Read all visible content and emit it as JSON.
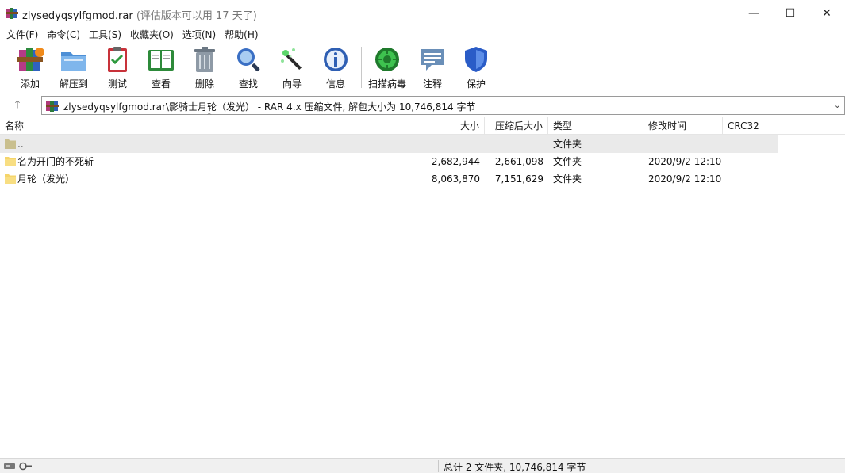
{
  "window": {
    "title": "zlysedyqsylfgmod.rar",
    "trial_note": "(评估版本可以用 17 天了)",
    "minimize_glyph": "—",
    "maximize_glyph": "☐",
    "close_glyph": "✕"
  },
  "menu": [
    {
      "label": "文件(F)"
    },
    {
      "label": "命令(C)"
    },
    {
      "label": "工具(S)"
    },
    {
      "label": "收藏夹(O)"
    },
    {
      "label": "选项(N)"
    },
    {
      "label": "帮助(H)"
    }
  ],
  "toolbar": [
    {
      "label": "添加",
      "icon": "add-archive-icon"
    },
    {
      "label": "解压到",
      "icon": "extract-folder-icon"
    },
    {
      "label": "测试",
      "icon": "test-clipboard-icon"
    },
    {
      "label": "查看",
      "icon": "view-book-icon"
    },
    {
      "label": "删除",
      "icon": "trash-icon"
    },
    {
      "label": "查找",
      "icon": "magnifier-icon"
    },
    {
      "label": "向导",
      "icon": "wizard-wand-icon"
    },
    {
      "label": "信息",
      "icon": "info-icon"
    },
    {
      "label": "扫描病毒",
      "icon": "virus-scan-icon"
    },
    {
      "label": "注释",
      "icon": "comment-icon"
    },
    {
      "label": "保护",
      "icon": "shield-icon"
    }
  ],
  "address": {
    "up_glyph": "🡑",
    "path": "zlysedyqsylfgmod.rar\\影骑士月轮（发光） - RAR 4.x 压缩文件, 解包大小为 10,746,814 字节"
  },
  "columns": {
    "name": "名称",
    "size": "大小",
    "packed": "压缩后大小",
    "type": "类型",
    "modified": "修改时间",
    "crc": "CRC32"
  },
  "files": [
    {
      "name": "..",
      "size": "",
      "packed": "",
      "type": "文件夹",
      "modified": "",
      "crc": "",
      "parent": true
    },
    {
      "name": "名为开门的不死斩",
      "size": "2,682,944",
      "packed": "2,661,098",
      "type": "文件夹",
      "modified": "2020/9/2 12:10",
      "crc": ""
    },
    {
      "name": "月轮（发光）",
      "size": "8,063,870",
      "packed": "7,151,629",
      "type": "文件夹",
      "modified": "2020/9/2 12:10",
      "crc": ""
    }
  ],
  "status": {
    "summary": "总计 2 文件夹, 10,746,814 字节"
  },
  "colors": {
    "folder": "#f5d56b",
    "parent_folder": "#c9bf8e",
    "selected_row": "#eaeaea"
  }
}
